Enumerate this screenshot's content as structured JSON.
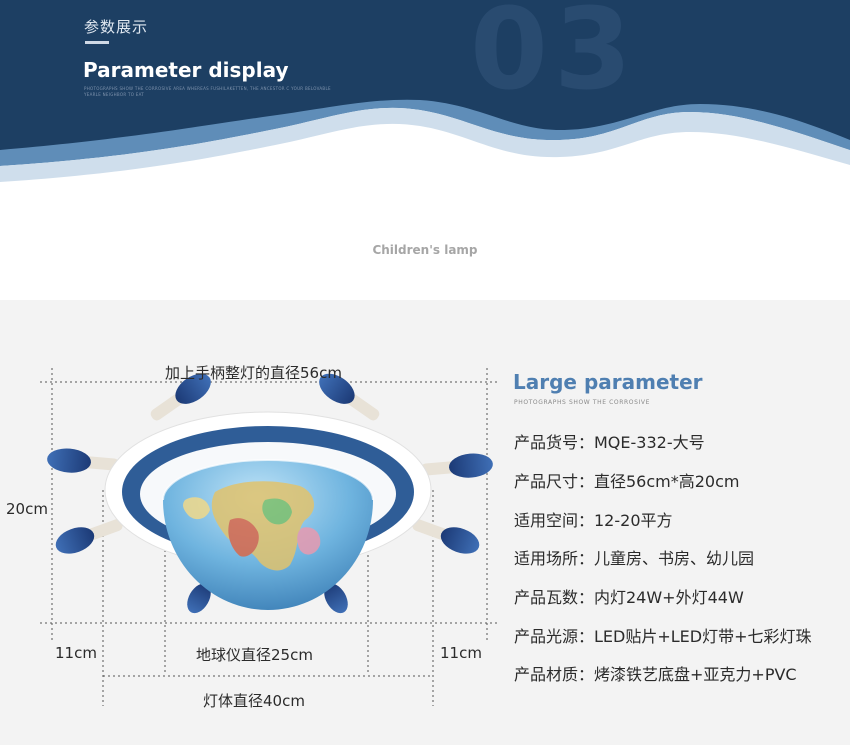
{
  "header": {
    "title_cn": "参数展示",
    "title_en": "Parameter display",
    "small_text": "PHOTOGRAPHS SHOW THE CORROSIVE AREA WHEREAS FUSHILAKETTEN, THE ANCESTOR C YOUR BELOVABLE YEARLE NEIGHBOR TO EAT",
    "bg_number": "03",
    "bg_color": "#1d3f63"
  },
  "subtitle": "Children's lamp",
  "dimensions": {
    "handle_diameter": "加上手柄整灯的直径56cm",
    "height": "20cm",
    "globe_diameter": "地球仪直径25cm",
    "side_left": "11cm",
    "side_right": "11cm",
    "body_diameter": "灯体直径40cm"
  },
  "params": {
    "title": "Large parameter",
    "subtitle": "PHOTOGRAPHS SHOW THE CORROSIVE",
    "rows": [
      "产品货号：MQE-332-大号",
      "产品尺寸：直径56cm*高20cm",
      "适用空间：12-20平方",
      "适用场所：儿童房、书房、幼儿园",
      "产品瓦数：内灯24W+外灯44W",
      "产品光源：LED贴片+LED灯带+七彩灯珠",
      "产品材质：烤漆铁艺底盘+亚克力+PVC"
    ]
  },
  "colors": {
    "accent": "#4f7fb1",
    "navy": "#1d3f63",
    "panel": "#f3f3f3"
  }
}
